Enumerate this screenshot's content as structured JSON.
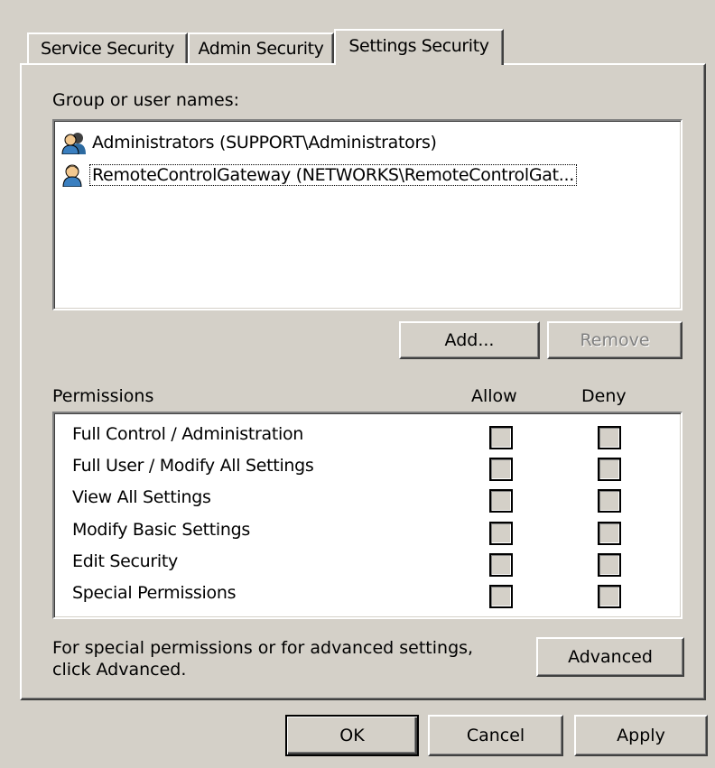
{
  "tabs": [
    {
      "label": "Service Security"
    },
    {
      "label": "Admin Security"
    },
    {
      "label": "Settings Security"
    }
  ],
  "group_label": "Group or user names:",
  "users": [
    {
      "name": "Administrators (SUPPORT\\Administrators)",
      "icon": "user-group-icon"
    },
    {
      "name": "RemoteControlGateway (NETWORKS\\RemoteControlGat...",
      "icon": "user-icon"
    }
  ],
  "buttons": {
    "add": "Add...",
    "remove": "Remove",
    "advanced": "Advanced",
    "ok": "OK",
    "cancel": "Cancel",
    "apply": "Apply"
  },
  "permissions": {
    "header": "Permissions",
    "allow_header": "Allow",
    "deny_header": "Deny",
    "items": [
      {
        "label": "Full Control / Administration",
        "allow": false,
        "deny": false
      },
      {
        "label": "Full User / Modify All Settings",
        "allow": false,
        "deny": false
      },
      {
        "label": "View All Settings",
        "allow": false,
        "deny": false
      },
      {
        "label": "Modify Basic Settings",
        "allow": false,
        "deny": false
      },
      {
        "label": "Edit Security",
        "allow": false,
        "deny": false
      },
      {
        "label": "Special Permissions",
        "allow": false,
        "deny": false
      }
    ]
  },
  "advanced_note": {
    "line1": "For special permissions or for advanced settings,",
    "line2": "click Advanced."
  }
}
